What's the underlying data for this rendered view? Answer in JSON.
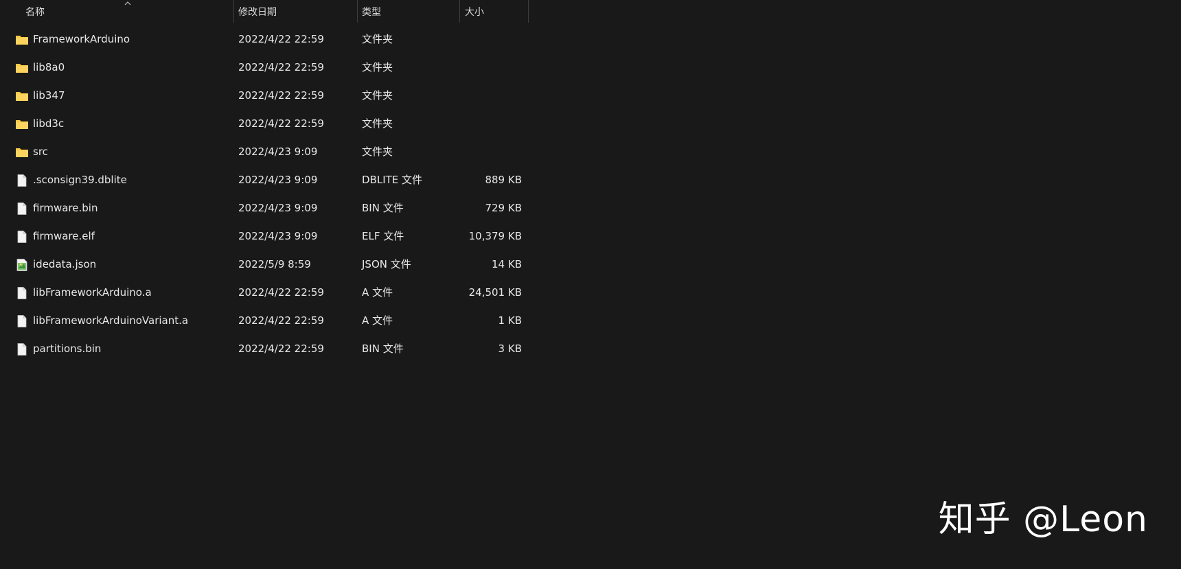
{
  "columns": {
    "name": "名称",
    "date": "修改日期",
    "type": "类型",
    "size": "大小"
  },
  "files": [
    {
      "name": "FrameworkArduino",
      "date": "2022/4/22 22:59",
      "type": "文件夹",
      "size": "",
      "icon": "folder-icon"
    },
    {
      "name": "lib8a0",
      "date": "2022/4/22 22:59",
      "type": "文件夹",
      "size": "",
      "icon": "folder-icon"
    },
    {
      "name": "lib347",
      "date": "2022/4/22 22:59",
      "type": "文件夹",
      "size": "",
      "icon": "folder-icon"
    },
    {
      "name": "libd3c",
      "date": "2022/4/22 22:59",
      "type": "文件夹",
      "size": "",
      "icon": "folder-icon"
    },
    {
      "name": "src",
      "date": "2022/4/23 9:09",
      "type": "文件夹",
      "size": "",
      "icon": "folder-icon"
    },
    {
      "name": ".sconsign39.dblite",
      "date": "2022/4/23 9:09",
      "type": "DBLITE 文件",
      "size": "889 KB",
      "icon": "file-icon"
    },
    {
      "name": "firmware.bin",
      "date": "2022/4/23 9:09",
      "type": "BIN 文件",
      "size": "729 KB",
      "icon": "file-icon"
    },
    {
      "name": "firmware.elf",
      "date": "2022/4/23 9:09",
      "type": "ELF 文件",
      "size": "10,379 KB",
      "icon": "file-icon"
    },
    {
      "name": "idedata.json",
      "date": "2022/5/9 8:59",
      "type": "JSON 文件",
      "size": "14 KB",
      "icon": "json-file-icon"
    },
    {
      "name": "libFrameworkArduino.a",
      "date": "2022/4/22 22:59",
      "type": "A 文件",
      "size": "24,501 KB",
      "icon": "file-icon"
    },
    {
      "name": "libFrameworkArduinoVariant.a",
      "date": "2022/4/22 22:59",
      "type": "A 文件",
      "size": "1 KB",
      "icon": "file-icon"
    },
    {
      "name": "partitions.bin",
      "date": "2022/4/22 22:59",
      "type": "BIN 文件",
      "size": "3 KB",
      "icon": "file-icon"
    }
  ],
  "watermark": "知乎 @Leon",
  "colors": {
    "background": "#191919",
    "folder": "#f5c84c",
    "text": "#e8e8e8"
  }
}
